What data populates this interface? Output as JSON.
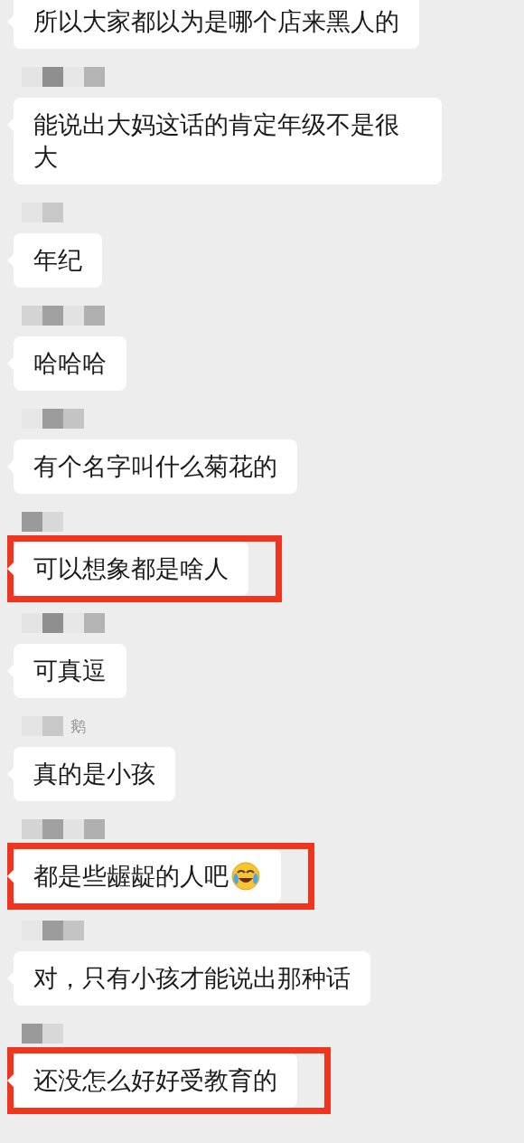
{
  "messages": [
    {
      "text": "所以大家都以为是哪个店来黑人的",
      "highlighted": false,
      "show_name": false
    },
    {
      "text": "能说出大妈这话的肯定年级不是很大",
      "highlighted": false,
      "show_name": true
    },
    {
      "text": "年纪",
      "highlighted": false,
      "show_name": true
    },
    {
      "text": "哈哈哈",
      "highlighted": false,
      "show_name": true
    },
    {
      "text": "有个名字叫什么菊花的",
      "highlighted": false,
      "show_name": true
    },
    {
      "text": "可以想象都是啥人",
      "highlighted": true,
      "show_name": true
    },
    {
      "text": "可真逗",
      "highlighted": false,
      "show_name": true
    },
    {
      "text": "真的是小孩",
      "highlighted": false,
      "show_name": true,
      "name_fragment": "鹅"
    },
    {
      "text": "都是些龌龊的人吧",
      "highlighted": true,
      "show_name": true,
      "emoji": true
    },
    {
      "text": "对，只有小孩才能说出那种话",
      "highlighted": false,
      "show_name": true
    },
    {
      "text": "还没怎么好好受教育的",
      "highlighted": true,
      "show_name": true
    }
  ]
}
